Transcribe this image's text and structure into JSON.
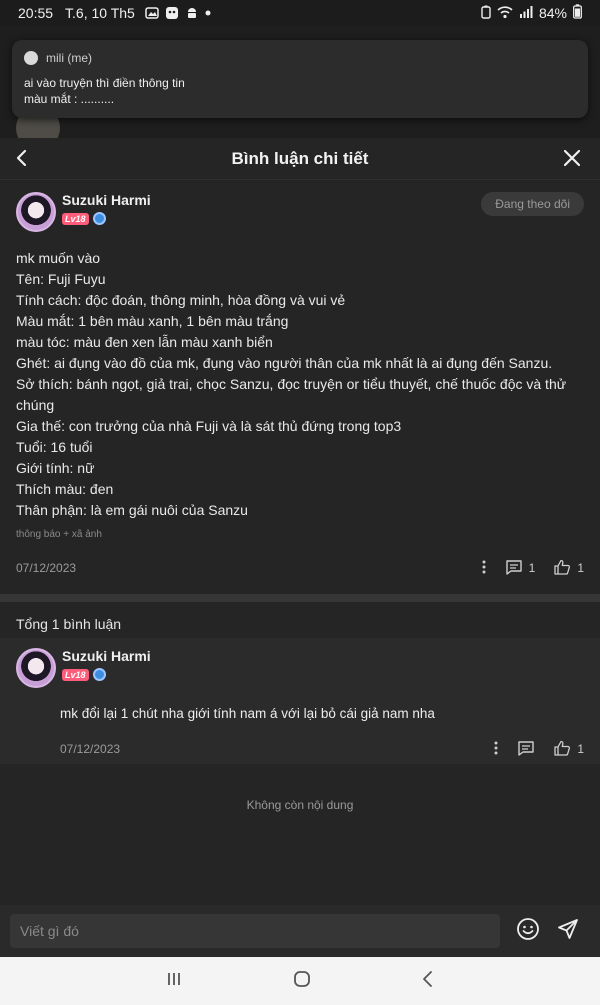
{
  "status_bar": {
    "time": "20:55",
    "date": "T.6, 10 Th5",
    "battery": "84%"
  },
  "notification": {
    "sender": "mili (me)",
    "message": "ai vào truyện thì điền thông tin\nmàu mắt : .........."
  },
  "header": {
    "title": "Bình luận chi tiết"
  },
  "post": {
    "author": "Suzuki Harmi",
    "level": "Lv18",
    "follow_label": "Đang theo dõi",
    "lines": [
      "mk muốn vào",
      "Tên: Fuji Fuyu",
      "Tính cách: độc đoán, thông minh, hòa đồng và vui vẻ",
      "Màu mắt: 1 bên màu xanh, 1 bên màu trắng",
      "màu tóc: màu đen xen lẫn màu xanh biển",
      "Ghét: ai đụng vào đồ của mk, đụng vào người thân của mk nhất là ai đụng đến Sanzu.",
      "Sở thích: bánh ngọt, giả trai, chọc Sanzu, đọc truyện or tiểu thuyết, chế thuốc độc và thử chúng",
      "Gia thế: con trưởng của nhà Fuji và là sát thủ đứng trong top3",
      "Tuổi: 16 tuổi",
      "Giới tính: nữ",
      "Thích màu: đen",
      "Thân phận: là em gái nuôi của Sanzu"
    ],
    "note": "thông báo + xã ảnh",
    "date": "07/12/2023",
    "comment_count": "1",
    "like_count": "1"
  },
  "comments_section": {
    "total_label": "Tổng 1 bình luận",
    "comments": [
      {
        "author": "Suzuki Harmi",
        "level": "Lv18",
        "text": "mk đổi lại 1 chút nha giới tính nam á với lại bỏ cái giả nam nha",
        "date": "07/12/2023",
        "like_count": "1"
      }
    ],
    "end_label": "Không còn nội dung"
  },
  "input": {
    "placeholder": "Viết gì đó"
  },
  "colors": {
    "background": "#242424",
    "level_badge": "#ff5b7a",
    "verified_badge": "#3f8de0"
  }
}
